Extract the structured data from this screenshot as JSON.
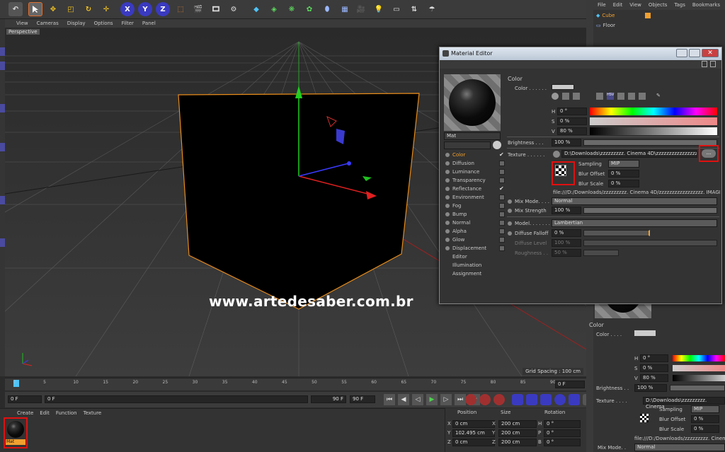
{
  "app": {
    "menu": [
      "View",
      "Cameras",
      "Display",
      "Options",
      "Filter",
      "Panel"
    ],
    "viewport_label": "Perspective",
    "grid_spacing": "Grid Spacing : 100 cm",
    "watermark": "www.artedesaber.com.br"
  },
  "toolbar": {
    "icons": [
      "undo-icon",
      "live-selection-icon",
      "move-icon",
      "scale-icon",
      "rotate-icon",
      "move-tool-icon",
      "x-axis-icon",
      "y-axis-icon",
      "z-axis-icon",
      "world-coordinates-icon",
      "render-view-icon",
      "render-picture-viewer-icon",
      "render-settings-icon",
      "cube-primitive-icon",
      "nurbs-icon",
      "array-icon",
      "deformer-icon",
      "environment-icon",
      "camera-icon",
      "light-icon",
      "scene-icon",
      "tags-icon",
      "snap-icon"
    ],
    "x": "X",
    "y": "Y",
    "z": "Z"
  },
  "timeline": {
    "ticks": [
      "0",
      "5",
      "10",
      "15",
      "20",
      "25",
      "30",
      "35",
      "40",
      "45",
      "50",
      "55",
      "60",
      "65",
      "70",
      "75",
      "80",
      "85",
      "90"
    ],
    "frame_field": "0 F"
  },
  "transport": {
    "start": "0 F",
    "current": "0 F",
    "end_field": "90 F",
    "end": "90 F"
  },
  "matmgr": {
    "menu": [
      "Create",
      "Edit",
      "Function",
      "Texture"
    ],
    "material_name": "Mat"
  },
  "coords": {
    "headers": [
      "Position",
      "Size",
      "Rotation"
    ],
    "rows": [
      {
        "axis": "X",
        "pos": "0 cm",
        "size": "200 cm",
        "rlabel": "H",
        "rot": "0 °"
      },
      {
        "axis": "Y",
        "pos": "102.495 cm",
        "size": "200 cm",
        "rlabel": "P",
        "rot": "0 °"
      },
      {
        "axis": "Z",
        "pos": "0 cm",
        "size": "200 cm",
        "rlabel": "B",
        "rot": "0 °"
      }
    ]
  },
  "objects": {
    "menu": [
      "File",
      "Edit",
      "View",
      "Objects",
      "Tags",
      "Bookmarks"
    ],
    "items": [
      "Cube",
      "Floor"
    ]
  },
  "mated": {
    "title": "Material Editor",
    "material_name": "Mat",
    "channels": [
      {
        "name": "Color",
        "check": "✔"
      },
      {
        "name": "Diffusion",
        "check": ""
      },
      {
        "name": "Luminance",
        "check": ""
      },
      {
        "name": "Transparency",
        "check": ""
      },
      {
        "name": "Reflectance",
        "check": "✔"
      },
      {
        "name": "Environment",
        "check": ""
      },
      {
        "name": "Fog",
        "check": ""
      },
      {
        "name": "Bump",
        "check": ""
      },
      {
        "name": "Normal",
        "check": ""
      },
      {
        "name": "Alpha",
        "check": ""
      },
      {
        "name": "Glow",
        "check": ""
      },
      {
        "name": "Displacement",
        "check": ""
      }
    ],
    "sections": [
      "Editor",
      "Illumination",
      "Assignment"
    ],
    "section_title": "Color",
    "color_label": "Color . . . . . .",
    "h": {
      "label": "H",
      "value": "0 °"
    },
    "s": {
      "label": "S",
      "value": "0 %"
    },
    "v": {
      "label": "V",
      "value": "80 %"
    },
    "brightness": {
      "label": "Brightness . . .",
      "value": "100 %"
    },
    "texture": {
      "label": "Texture . . . . . .",
      "path": "D:\\Downloads\\zzzzzzzzz. Cinema 4D\\zzzzzzzzzzzzzzzz",
      "button": "..."
    },
    "sampling": {
      "label": "Sampling",
      "value": "MIP"
    },
    "blur_offset": {
      "label": "Blur Offset",
      "value": "0 %"
    },
    "blur_scale": {
      "label": "Blur Scale",
      "value": "0 %"
    },
    "file_path": "file:///D:/Downloads/zzzzzzzzz. Cinema 4D/zzzzzzzzzzzzzzzzz. IMAGE",
    "mix_mode": {
      "label": "Mix Mode. . . .",
      "value": "Normal"
    },
    "mix_strength": {
      "label": "Mix Strength",
      "value": "100 %"
    },
    "model": {
      "label": "Model. . . . . . . .",
      "value": "Lambertian"
    },
    "diffuse_falloff": {
      "label": "Diffuse Falloff",
      "value": "0 %"
    },
    "diffuse_level": {
      "label": "Diffuse Level",
      "value": "100 %"
    },
    "roughness": {
      "label": "Roughness . .",
      "value": "50 %"
    }
  },
  "attr": {
    "section_title": "Color",
    "color_label": "Color . . . .",
    "h": "0 °",
    "s": "0 %",
    "v": "80 %",
    "brightness_label": "Brightness . .",
    "brightness": "100 %",
    "texture_label": "Texture . . . .",
    "texture_path": "D:\\Downloads\\zzzzzzzzz. Cinema",
    "sampling_label": "Sampling",
    "sampling": "MIP",
    "blur_offset_label": "Blur Offset",
    "blur_offset": "0 %",
    "blur_scale_label": "Blur Scale",
    "blur_scale": "0 %",
    "file_path": "file:///D:/Downloads/zzzzzzzzz. Cinem",
    "mix_mode_label": "Mix Mode. .",
    "mix_mode": "Normal"
  },
  "colors": {
    "accent": "#f0a030",
    "highlight_box": "#e01010",
    "selection_blue": "#4a4aa0"
  }
}
